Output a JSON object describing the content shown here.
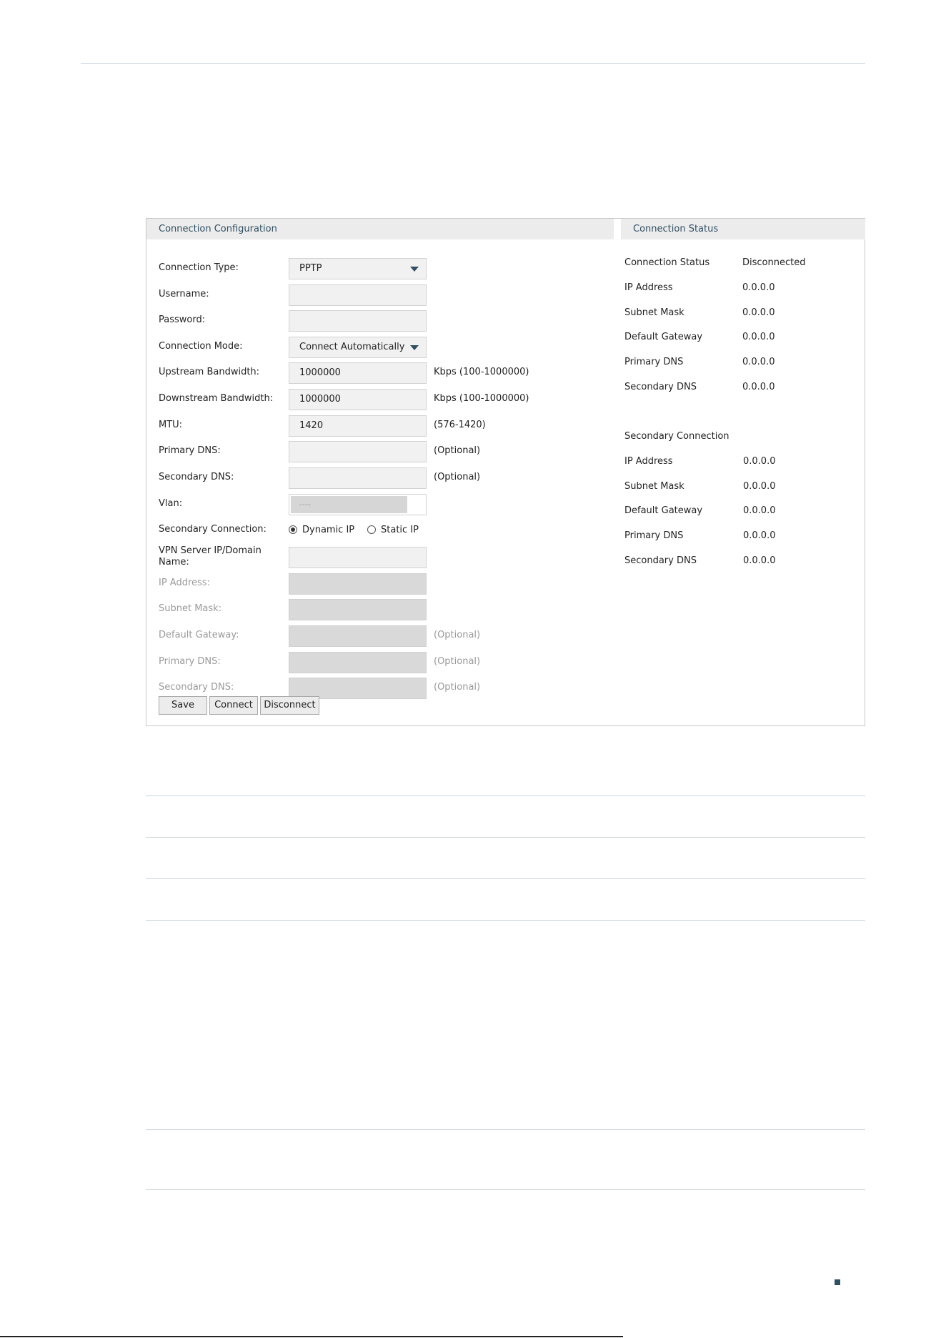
{
  "config": {
    "header": "Connection Configuration",
    "connection_type": {
      "label": "Connection Type:",
      "value": "PPTP"
    },
    "username": {
      "label": "Username:",
      "value": ""
    },
    "password": {
      "label": "Password:",
      "value": ""
    },
    "connection_mode": {
      "label": "Connection Mode:",
      "value": "Connect Automatically"
    },
    "upstream": {
      "label": "Upstream Bandwidth:",
      "value": "1000000",
      "hint": "Kbps (100-1000000)"
    },
    "downstream": {
      "label": "Downstream Bandwidth:",
      "value": "1000000",
      "hint": "Kbps (100-1000000)"
    },
    "mtu": {
      "label": "MTU:",
      "value": "1420",
      "hint": "(576-1420)"
    },
    "primary_dns": {
      "label": "Primary DNS:",
      "value": "",
      "hint": "(Optional)"
    },
    "secondary_dns": {
      "label": "Secondary DNS:",
      "value": "",
      "hint": "(Optional)"
    },
    "vlan": {
      "label": "Vlan:",
      "value": "----"
    },
    "secondary_connection": {
      "label": "Secondary Connection:",
      "options": [
        "Dynamic IP",
        "Static IP"
      ],
      "selected": "Dynamic IP"
    },
    "vpn_server": {
      "label": "VPN Server IP/Domain Name:",
      "value": ""
    },
    "sec_ip": {
      "label": "IP Address:",
      "value": ""
    },
    "sec_mask": {
      "label": "Subnet Mask:",
      "value": ""
    },
    "sec_gateway": {
      "label": "Default Gateway:",
      "value": "",
      "hint": "(Optional)"
    },
    "sec_primary_dns": {
      "label": "Primary DNS:",
      "value": "",
      "hint": "(Optional)"
    },
    "sec_secondary_dns": {
      "label": "Secondary DNS:",
      "value": "",
      "hint": "(Optional)"
    },
    "buttons": {
      "save": "Save",
      "connect": "Connect",
      "disconnect": "Disconnect"
    }
  },
  "status": {
    "header": "Connection Status",
    "primary": [
      {
        "label": "Connection Status",
        "value": "Disconnected"
      },
      {
        "label": "IP Address",
        "value": "0.0.0.0"
      },
      {
        "label": "Subnet Mask",
        "value": "0.0.0.0"
      },
      {
        "label": "Default Gateway",
        "value": "0.0.0.0"
      },
      {
        "label": "Primary DNS",
        "value": "0.0.0.0"
      },
      {
        "label": "Secondary DNS",
        "value": "0.0.0.0"
      }
    ],
    "secondary_title": "Secondary Connection",
    "secondary": [
      {
        "label": "IP Address",
        "value": "0.0.0.0"
      },
      {
        "label": "Subnet Mask",
        "value": "0.0.0.0"
      },
      {
        "label": "Default Gateway",
        "value": "0.0.0.0"
      },
      {
        "label": "Primary DNS",
        "value": "0.0.0.0"
      },
      {
        "label": "Secondary DNS",
        "value": "0.0.0.0"
      }
    ]
  },
  "colors": {
    "accent": "#2f4f62",
    "header_bg": "#ececec",
    "input_bg": "#f1f1f1",
    "disabled_bg": "#d9d9d9"
  }
}
